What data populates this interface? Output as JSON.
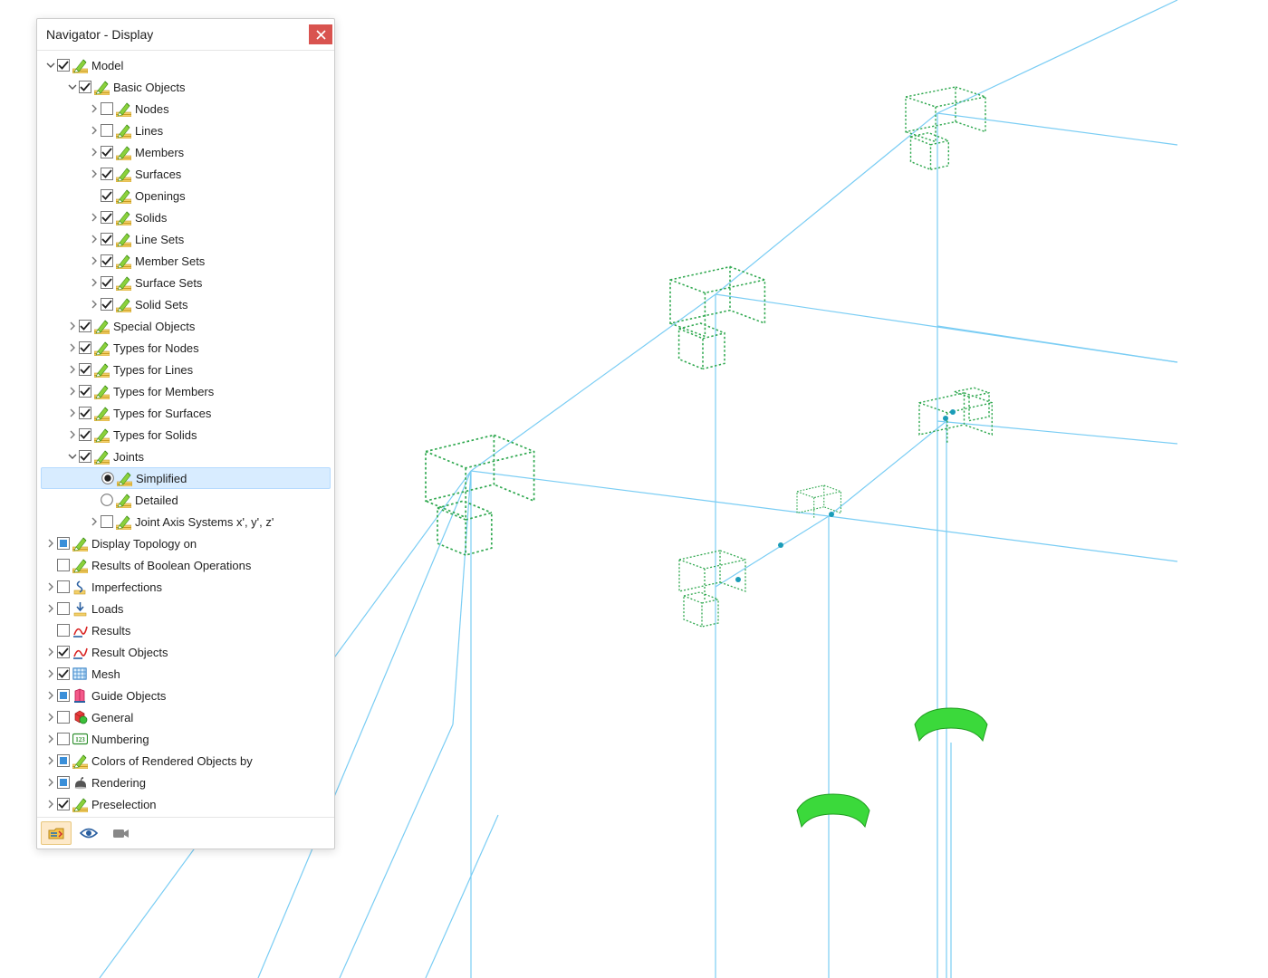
{
  "panel": {
    "title": "Navigator - Display"
  },
  "footer_icons": [
    "project-icon",
    "eye-icon",
    "camera-icon"
  ],
  "tree": [
    {
      "id": "model",
      "label": "Model",
      "level": 0,
      "twisty": "open",
      "check": "checked",
      "icon": "edit"
    },
    {
      "id": "basic",
      "label": "Basic Objects",
      "level": 1,
      "twisty": "open",
      "check": "checked",
      "icon": "edit"
    },
    {
      "id": "nodes",
      "label": "Nodes",
      "level": 2,
      "twisty": "closed",
      "check": "unchecked",
      "icon": "edit"
    },
    {
      "id": "lines",
      "label": "Lines",
      "level": 2,
      "twisty": "closed",
      "check": "unchecked",
      "icon": "edit"
    },
    {
      "id": "members",
      "label": "Members",
      "level": 2,
      "twisty": "closed",
      "check": "checked",
      "icon": "edit"
    },
    {
      "id": "surfaces",
      "label": "Surfaces",
      "level": 2,
      "twisty": "closed",
      "check": "checked",
      "icon": "edit"
    },
    {
      "id": "openings",
      "label": "Openings",
      "level": 2,
      "twisty": "none",
      "check": "checked",
      "icon": "edit"
    },
    {
      "id": "solids",
      "label": "Solids",
      "level": 2,
      "twisty": "closed",
      "check": "checked",
      "icon": "edit"
    },
    {
      "id": "linesets",
      "label": "Line Sets",
      "level": 2,
      "twisty": "closed",
      "check": "checked",
      "icon": "edit"
    },
    {
      "id": "membersets",
      "label": "Member Sets",
      "level": 2,
      "twisty": "closed",
      "check": "checked",
      "icon": "edit"
    },
    {
      "id": "surfacesets",
      "label": "Surface Sets",
      "level": 2,
      "twisty": "closed",
      "check": "checked",
      "icon": "edit"
    },
    {
      "id": "solidsets",
      "label": "Solid Sets",
      "level": 2,
      "twisty": "closed",
      "check": "checked",
      "icon": "edit"
    },
    {
      "id": "special",
      "label": "Special Objects",
      "level": 1,
      "twisty": "closed",
      "check": "checked",
      "icon": "edit"
    },
    {
      "id": "tnodes",
      "label": "Types for Nodes",
      "level": 1,
      "twisty": "closed",
      "check": "checked",
      "icon": "edit"
    },
    {
      "id": "tlines",
      "label": "Types for Lines",
      "level": 1,
      "twisty": "closed",
      "check": "checked",
      "icon": "edit"
    },
    {
      "id": "tmembers",
      "label": "Types for Members",
      "level": 1,
      "twisty": "closed",
      "check": "checked",
      "icon": "edit"
    },
    {
      "id": "tsurfaces",
      "label": "Types for Surfaces",
      "level": 1,
      "twisty": "closed",
      "check": "checked",
      "icon": "edit"
    },
    {
      "id": "tsolids",
      "label": "Types for Solids",
      "level": 1,
      "twisty": "closed",
      "check": "checked",
      "icon": "edit"
    },
    {
      "id": "joints",
      "label": "Joints",
      "level": 1,
      "twisty": "open",
      "check": "checked",
      "icon": "edit"
    },
    {
      "id": "simplified",
      "label": "Simplified",
      "level": 2,
      "twisty": "none",
      "radio": "checked",
      "icon": "edit",
      "selected": true
    },
    {
      "id": "detailed",
      "label": "Detailed",
      "level": 2,
      "twisty": "none",
      "radio": "unchecked",
      "icon": "edit"
    },
    {
      "id": "jointaxis",
      "label": "Joint Axis Systems x', y', z'",
      "level": 2,
      "twisty": "closed",
      "check": "unchecked",
      "icon": "edit"
    },
    {
      "id": "topo",
      "label": "Display Topology on",
      "level": 0,
      "twisty": "closed",
      "check": "blue",
      "icon": "edit"
    },
    {
      "id": "boolres",
      "label": "Results of Boolean Operations",
      "level": 0,
      "twisty": "none",
      "check": "unchecked",
      "icon": "edit"
    },
    {
      "id": "imperf",
      "label": "Imperfections",
      "level": 0,
      "twisty": "closed",
      "check": "unchecked",
      "icon": "imperf"
    },
    {
      "id": "loads",
      "label": "Loads",
      "level": 0,
      "twisty": "closed",
      "check": "unchecked",
      "icon": "loads"
    },
    {
      "id": "results",
      "label": "Results",
      "level": 0,
      "twisty": "none",
      "check": "unchecked",
      "icon": "results"
    },
    {
      "id": "robj",
      "label": "Result Objects",
      "level": 0,
      "twisty": "closed",
      "check": "checked",
      "icon": "results"
    },
    {
      "id": "mesh",
      "label": "Mesh",
      "level": 0,
      "twisty": "closed",
      "check": "checked",
      "icon": "mesh"
    },
    {
      "id": "guide",
      "label": "Guide Objects",
      "level": 0,
      "twisty": "closed",
      "check": "blue",
      "icon": "guide"
    },
    {
      "id": "general",
      "label": "General",
      "level": 0,
      "twisty": "closed",
      "check": "unchecked",
      "icon": "general"
    },
    {
      "id": "numbering",
      "label": "Numbering",
      "level": 0,
      "twisty": "closed",
      "check": "unchecked",
      "icon": "numbering"
    },
    {
      "id": "colors",
      "label": "Colors of Rendered Objects by",
      "level": 0,
      "twisty": "closed",
      "check": "blue",
      "icon": "edit"
    },
    {
      "id": "rendering",
      "label": "Rendering",
      "level": 0,
      "twisty": "closed",
      "check": "blue",
      "icon": "rendering"
    },
    {
      "id": "presel",
      "label": "Preselection",
      "level": 0,
      "twisty": "closed",
      "check": "checked",
      "icon": "edit"
    }
  ]
}
